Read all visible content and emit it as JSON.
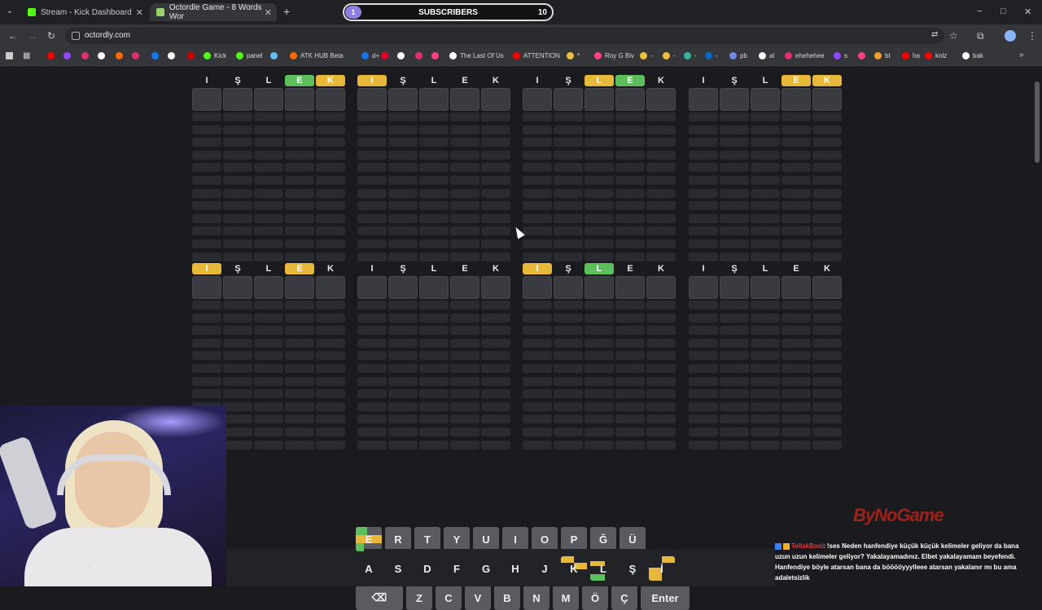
{
  "browser": {
    "tabs": [
      {
        "title": "Stream - Kick Dashboard",
        "fav_color": "#53fc18"
      },
      {
        "title": "Octordle Game - 8 Words Wor",
        "fav_color": "#9ad36a"
      }
    ],
    "new_tab": "+",
    "url": "octordly.com",
    "window_controls": [
      "−",
      "□",
      "✕"
    ],
    "bookmarks": [
      {
        "label": "",
        "color": "#ff0000"
      },
      {
        "label": "",
        "color": "#9146ff"
      },
      {
        "label": "",
        "color": "#e1306c"
      },
      {
        "label": "",
        "color": "#ffffff"
      },
      {
        "label": "",
        "color": "#ff6a00"
      },
      {
        "label": "",
        "color": "#e1306c"
      },
      {
        "label": "",
        "color": "#1877f2"
      },
      {
        "label": "",
        "color": "#ffffff"
      },
      {
        "label": "",
        "color": "#d00000"
      },
      {
        "label": "Kick",
        "color": "#53fc18"
      },
      {
        "label": "panel",
        "color": "#53fc18"
      },
      {
        "label": "",
        "color": "#66c0f4"
      },
      {
        "label": "ATK HUB Beta",
        "color": "#ff6a00"
      },
      {
        "label": "d+",
        "color": "#1a73e8"
      },
      {
        "label": "",
        "color": "#e60023"
      },
      {
        "label": "",
        "color": "#ffffff"
      },
      {
        "label": "",
        "color": "#e1306c"
      },
      {
        "label": "",
        "color": "#ff4081"
      },
      {
        "label": "The Last Of Us",
        "color": "#ffffff"
      },
      {
        "label": "ATTENTION",
        "color": "#ff0000"
      },
      {
        "label": "*",
        "color": "#f0c040"
      },
      {
        "label": "Roy G Biv",
        "color": "#ff4081"
      },
      {
        "label": "-",
        "color": "#f0c040"
      },
      {
        "label": "-",
        "color": "#f0c040"
      },
      {
        "label": "-",
        "color": "#3ab0a0"
      },
      {
        "label": "-",
        "color": "#0a66c2"
      },
      {
        "label": "pb",
        "color": "#7289da"
      },
      {
        "label": "al",
        "color": "#ffffff"
      },
      {
        "label": "ehehehee",
        "color": "#e1306c"
      },
      {
        "label": "s",
        "color": "#9146ff"
      },
      {
        "label": "",
        "color": "#ff4081"
      },
      {
        "label": "bt",
        "color": "#f0a030"
      },
      {
        "label": "ha",
        "color": "#ff0000"
      },
      {
        "label": "knlz",
        "color": "#ff0000"
      },
      {
        "label": "bak",
        "color": "#ffffff"
      }
    ]
  },
  "subscribers": {
    "label": "SUBSCRIBERS",
    "start": "1",
    "goal": "10",
    "progress": 0.1
  },
  "boards": [
    {
      "letters": [
        "I",
        "Ş",
        "L",
        "E",
        "K"
      ],
      "states": [
        "n",
        "n",
        "n",
        "g",
        "y"
      ]
    },
    {
      "letters": [
        "I",
        "Ş",
        "L",
        "E",
        "K"
      ],
      "states": [
        "y",
        "n",
        "n",
        "n",
        "n"
      ]
    },
    {
      "letters": [
        "I",
        "Ş",
        "L",
        "E",
        "K"
      ],
      "states": [
        "n",
        "n",
        "y",
        "g",
        "n"
      ]
    },
    {
      "letters": [
        "I",
        "Ş",
        "L",
        "E",
        "K"
      ],
      "states": [
        "n",
        "n",
        "n",
        "y",
        "y"
      ]
    },
    {
      "letters": [
        "I",
        "Ş",
        "L",
        "E",
        "K"
      ],
      "states": [
        "y",
        "n",
        "n",
        "y",
        "n"
      ]
    },
    {
      "letters": [
        "I",
        "Ş",
        "L",
        "E",
        "K"
      ],
      "states": [
        "n",
        "n",
        "n",
        "n",
        "n"
      ]
    },
    {
      "letters": [
        "I",
        "Ş",
        "L",
        "E",
        "K"
      ],
      "states": [
        "y",
        "n",
        "g",
        "n",
        "n"
      ]
    },
    {
      "letters": [
        "I",
        "Ş",
        "L",
        "E",
        "K"
      ],
      "states": [
        "n",
        "n",
        "n",
        "n",
        "n"
      ]
    }
  ],
  "keyboard": {
    "row1": [
      "E",
      "R",
      "T",
      "Y",
      "U",
      "I",
      "O",
      "P",
      "Ğ",
      "Ü"
    ],
    "row2": [
      "A",
      "S",
      "D",
      "F",
      "G",
      "H",
      "J",
      "K",
      "L",
      "Ş",
      "İ"
    ],
    "row3": [
      "⌫",
      "Z",
      "C",
      "V",
      "B",
      "N",
      "M",
      "Ö",
      "Ç",
      "Enter"
    ]
  },
  "overlay_logo": "ByNoGame",
  "chat": {
    "user": "TellakBasi",
    "message": ": !ses Neden hanfendiye küçük küçük kelimeler geliyor da bana uzun uzun kelimeler geliyor? Yakalayamadınız. Elbet yakalayamam beyefendi. Hanfendiye böyle atarsan bana da bööööyyylleee atarsan yakalanır mı bu ama adaletsizlik"
  },
  "colors": {
    "yellow": "#e8b83a",
    "green": "#5cbf5c",
    "key": "#5a5b61"
  }
}
